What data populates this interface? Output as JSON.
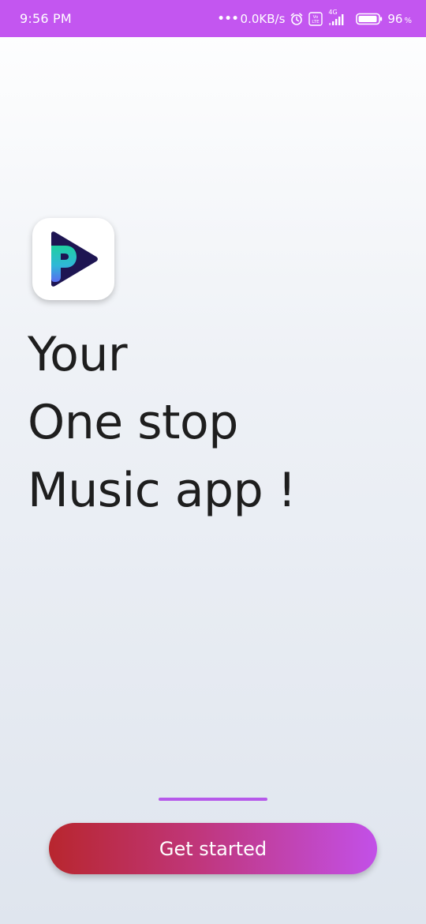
{
  "status_bar": {
    "time": "9:56 PM",
    "network_speed": "0.0KB/s",
    "network_type": "4G",
    "volte_label": "Vo LTE",
    "battery_level": "96",
    "battery_unit": "%",
    "battery_fraction": 0.96,
    "icons": [
      "more-dots-icon",
      "alarm-icon",
      "volte-icon",
      "signal-icon",
      "battery-icon"
    ]
  },
  "logo": {
    "icon": "play-logo-icon",
    "colors": {
      "triangle": "#1e1552",
      "letter_top": "#1fd0a0",
      "letter_bottom": "#5a6cf0"
    }
  },
  "headline": {
    "line1": "Your",
    "line2": "One stop",
    "line3": "Music app !"
  },
  "onboarding": {
    "indicator_color": "#b659ea"
  },
  "cta": {
    "label": "Get started",
    "gradient": [
      "#b8262e",
      "#c250e8"
    ]
  },
  "theme": {
    "status_bar_color": "#c356f0",
    "text_color": "#1e1e1e"
  }
}
